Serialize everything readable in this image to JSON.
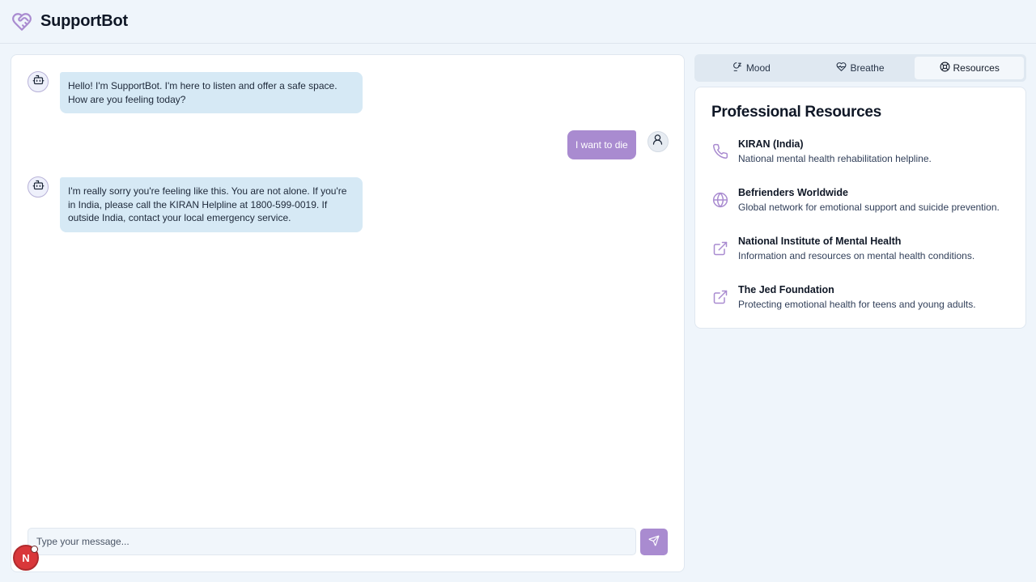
{
  "app": {
    "title": "SupportBot"
  },
  "colors": {
    "accent": "#a98bd0",
    "bot_bubble": "#d6e9f5",
    "background": "#eff5fb"
  },
  "chat": {
    "messages": [
      {
        "sender": "bot",
        "text": "Hello! I'm SupportBot. I'm here to listen and offer a safe space. How are you feeling today?"
      },
      {
        "sender": "user",
        "text": "I want to die"
      },
      {
        "sender": "bot",
        "text": "I'm really sorry you're feeling like this. You are not alone. If you're in India, please call the KIRAN Helpline at 1800-599-0019. If outside India, contact your local emergency service."
      }
    ],
    "input_placeholder": "Type your message...",
    "input_value": ""
  },
  "floating_badge": {
    "letter": "N"
  },
  "tabs": [
    {
      "label": "Mood",
      "icon": "mood-icon",
      "active": false
    },
    {
      "label": "Breathe",
      "icon": "heart-pulse-icon",
      "active": false
    },
    {
      "label": "Resources",
      "icon": "lifebuoy-icon",
      "active": true
    }
  ],
  "resources": {
    "title": "Professional Resources",
    "items": [
      {
        "name": "KIRAN (India)",
        "description": "National mental health rehabilitation helpline.",
        "icon": "phone-icon"
      },
      {
        "name": "Befrienders Worldwide",
        "description": "Global network for emotional support and suicide prevention.",
        "icon": "globe-icon"
      },
      {
        "name": "National Institute of Mental Health",
        "description": "Information and resources on mental health conditions.",
        "icon": "external-link-icon"
      },
      {
        "name": "The Jed Foundation",
        "description": "Protecting emotional health for teens and young adults.",
        "icon": "external-link-icon"
      }
    ]
  }
}
